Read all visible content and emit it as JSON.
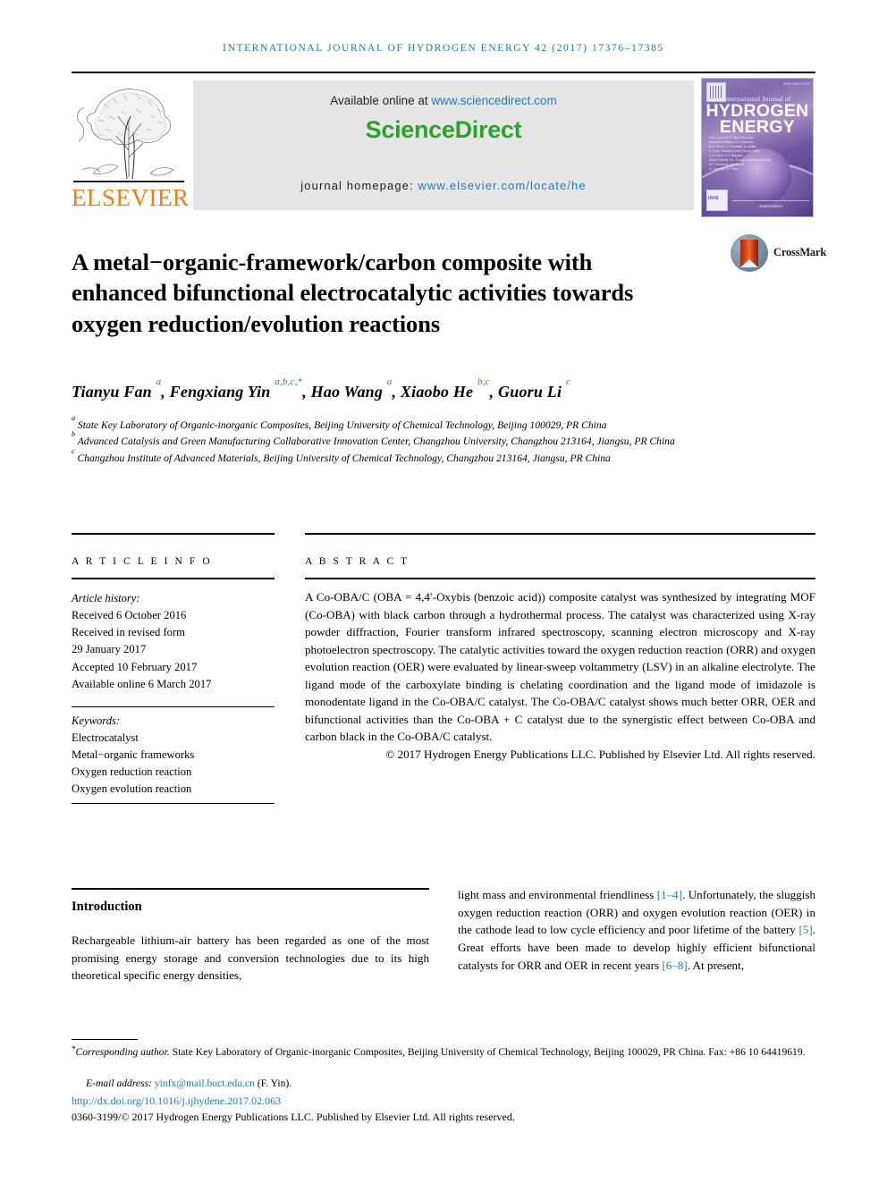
{
  "running_head": "International Journal of Hydrogen Energy 42 (2017) 17376–17385",
  "masthead": {
    "elsevier_wordmark": "ELSEVIER",
    "available_prefix": "Available online at ",
    "available_link": "www.sciencedirect.com",
    "sciencedirect_logo": "ScienceDirect",
    "homepage_prefix": "journal homepage: ",
    "homepage_link": "www.elsevier.com/locate/he",
    "cover": {
      "issn": "ISSN 0360-3199",
      "subtitle": "International Journal of",
      "title_line1": "HYDROGEN",
      "title_line2": "ENERGY",
      "meta_lines": [
        "Editor-in-Chief:   T. Nejat Veziroglu",
        "Associate Editors:   D.Y. Goswami,",
        "                      M.A. Rosen, A. Ozarslan, A. Kazim,",
        "                      S. Dunn, Ibrahim Dincer, Bruno Pollet,",
        "                      A.A. Evers, S.Z. Baykara",
        "Senior Editors:   Sh. Zhang, Amritanshu Shukla,",
        "                      D.Y. Goswami, A.A. Evers,",
        "                      A. Ozarslan, B. Pollet"
      ],
      "iahe_badge": "IAHE",
      "footer": "ScienceDirect"
    }
  },
  "crossmark": {
    "label": "CrossMark"
  },
  "title": "A metal−organic-framework/carbon composite with enhanced bifunctional electrocatalytic activities towards oxygen reduction/evolution reactions",
  "authors": [
    {
      "name": "Tianyu Fan",
      "marks": "a"
    },
    {
      "name": "Fengxiang Yin",
      "marks": "a,b,c,*"
    },
    {
      "name": "Hao Wang",
      "marks": "a"
    },
    {
      "name": "Xiaobo He",
      "marks": "b,c"
    },
    {
      "name": "Guoru Li",
      "marks": "c"
    }
  ],
  "affiliations": [
    {
      "mark": "a",
      "text": "State Key Laboratory of Organic-inorganic Composites, Beijing University of Chemical Technology, Beijing 100029, PR China"
    },
    {
      "mark": "b",
      "text": "Advanced Catalysis and Green Manufacturing Collaborative Innovation Center, Changzhou University, Changzhou 213164, Jiangsu, PR China"
    },
    {
      "mark": "c",
      "text": "Changzhou Institute of Advanced Materials, Beijing University of Chemical Technology, Changzhou 213164, Jiangsu, PR China"
    }
  ],
  "article_info": {
    "heading": "A R T I C L E   I N F O",
    "history_label": "Article history:",
    "history": [
      "Received 6 October 2016",
      "Received in revised form",
      "29 January 2017",
      "Accepted 10 February 2017",
      "Available online 6 March 2017"
    ],
    "keywords_label": "Keywords:",
    "keywords": [
      "Electrocatalyst",
      "Metal−organic frameworks",
      "Oxygen reduction reaction",
      "Oxygen evolution reaction"
    ]
  },
  "abstract": {
    "heading": "A B S T R A C T",
    "body": "A Co-OBA/C (OBA = 4,4′-Oxybis (benzoic acid)) composite catalyst was synthesized by integrating MOF (Co-OBA) with black carbon through a hydrothermal process. The catalyst was characterized using X-ray powder diffraction, Fourier transform infrared spectroscopy, scanning electron microscopy and X-ray photoelectron spectroscopy. The catalytic activities toward the oxygen reduction reaction (ORR) and oxygen evolution reaction (OER) were evaluated by linear-sweep voltammetry (LSV) in an alkaline electrolyte. The ligand mode of the carboxylate binding is chelating coordination and the ligand mode of imidazole is monodentate ligand in the Co-OBA/C catalyst. The Co-OBA/C catalyst shows much better ORR, OER and bifunctional activities than the Co-OBA + C catalyst due to the synergistic effect between Co-OBA and carbon black in the Co-OBA/C catalyst.",
    "copyright": "© 2017 Hydrogen Energy Publications LLC. Published by Elsevier Ltd. All rights reserved."
  },
  "body": {
    "section_heading": "Introduction",
    "left_paragraph": "Rechargeable lithium-air battery has been regarded as one of the most promising energy storage and conversion technologies due to its high theoretical specific energy densities,",
    "right_segments": [
      {
        "text": "light mass and environmental friendliness "
      },
      {
        "text": "[1–4]",
        "ref": true
      },
      {
        "text": ". Unfortunately, the sluggish oxygen reduction reaction (ORR) and oxygen evolution reaction (OER) in the cathode lead to low cycle efficiency and poor lifetime of the battery "
      },
      {
        "text": "[5]",
        "ref": true
      },
      {
        "text": ". Great efforts have been made to develop highly efficient bifunctional catalysts for ORR and OER in recent years "
      },
      {
        "text": "[6–8]",
        "ref": true
      },
      {
        "text": ". At present,"
      }
    ]
  },
  "footer": {
    "corresponding_star": "*",
    "corresponding_label": "Corresponding author.",
    "corresponding_text": " State Key Laboratory of Organic-inorganic Composites, Beijing University of Chemical Technology, Beijing 100029, PR China. Fax: +86 10 64419619.",
    "email_label": "E-mail address:",
    "email": "yinfx@mail.buct.edu.cn",
    "email_suffix": "(F. Yin).",
    "doi": "http://dx.doi.org/10.1016/j.ijhydene.2017.02.063",
    "issn_line": "0360-3199/© 2017 Hydrogen Energy Publications LLC. Published by Elsevier Ltd. All rights reserved."
  },
  "colors": {
    "link_blue": "#1f7bbf",
    "sciencedirect_green": "#29a329",
    "elsevier_orange": "#f07d17",
    "banner_gray": "#e6e6e6"
  }
}
